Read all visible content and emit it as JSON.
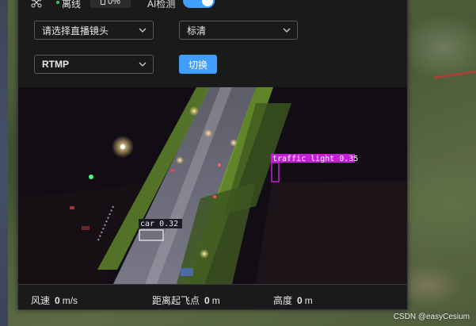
{
  "topbar": {
    "status": "离线",
    "battery": "0%",
    "ai_label": "AI检测",
    "ai_enabled": true
  },
  "controls": {
    "camera_select": "请选择直播镜头",
    "quality_select": "标清",
    "protocol_select": "RTMP",
    "switch_button": "切换"
  },
  "detections": [
    {
      "label": "traffic light 0.35",
      "color": "#c41fd6"
    },
    {
      "label": "car 0.32",
      "color": "#e8e8f0"
    }
  ],
  "stats": {
    "wind_label": "风速",
    "wind_value": "0",
    "wind_unit": "m/s",
    "distance_label": "距离起飞点",
    "distance_value": "0",
    "distance_unit": "m",
    "altitude_label": "高度",
    "altitude_value": "0",
    "altitude_unit": "m"
  },
  "watermark": "CSDN @easyCesium",
  "colors": {
    "accent": "#409eff",
    "panel": "#1a1a1b",
    "online_dot": "#35c26a"
  }
}
